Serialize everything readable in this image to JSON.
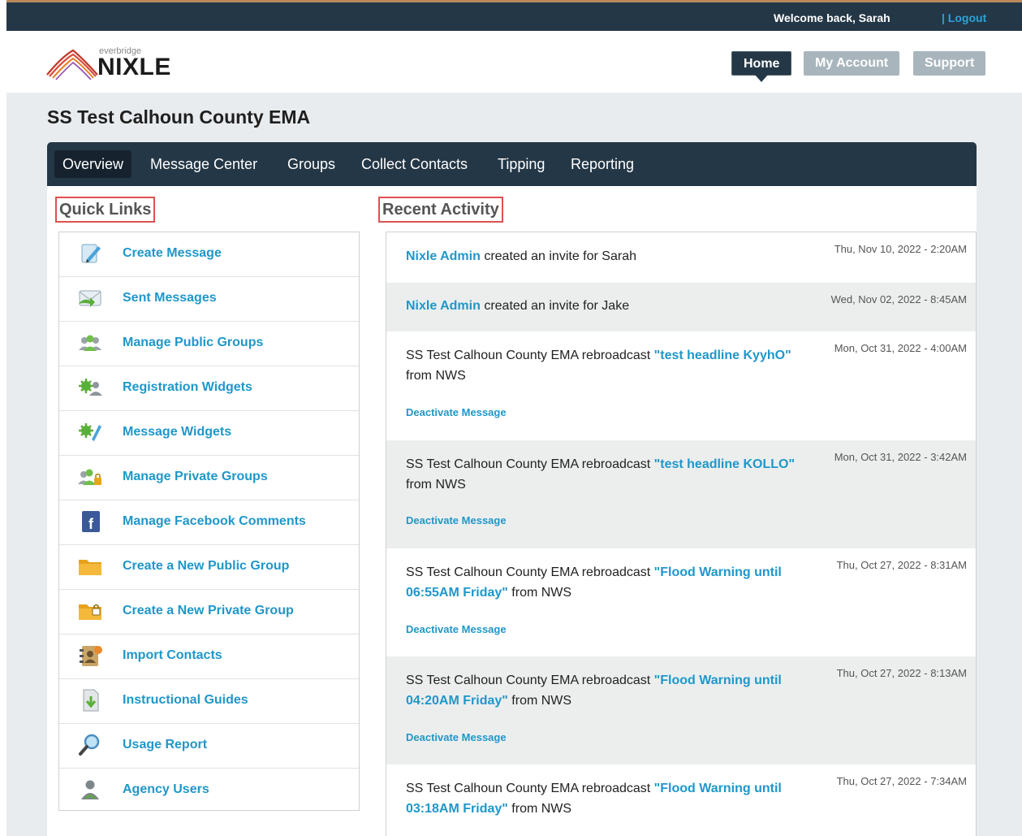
{
  "topbar": {
    "welcome": "Welcome back, Sarah",
    "logout": "| Logout"
  },
  "logo": {
    "small": "everbridge",
    "main": "NIXLE"
  },
  "header_nav": {
    "home": "Home",
    "my_account": "My Account",
    "support": "Support"
  },
  "page_title": "SS Test Calhoun County EMA",
  "main_nav": [
    {
      "label": "Overview"
    },
    {
      "label": "Message Center"
    },
    {
      "label": "Groups"
    },
    {
      "label": "Collect Contacts"
    },
    {
      "label": "Tipping"
    },
    {
      "label": "Reporting"
    }
  ],
  "quick_links": {
    "title": "Quick Links",
    "items": [
      {
        "label": "Create Message",
        "icon": "pencil-paper-icon"
      },
      {
        "label": "Sent Messages",
        "icon": "envelope-icon"
      },
      {
        "label": "Manage Public Groups",
        "icon": "group-icon"
      },
      {
        "label": "Registration Widgets",
        "icon": "gear-user-icon"
      },
      {
        "label": "Message Widgets",
        "icon": "gear-pencil-icon"
      },
      {
        "label": "Manage Private Groups",
        "icon": "private-group-icon"
      },
      {
        "label": "Manage Facebook Comments",
        "icon": "facebook-icon"
      },
      {
        "label": "Create a New Public Group",
        "icon": "folder-icon"
      },
      {
        "label": "Create a New Private Group",
        "icon": "locked-folder-icon"
      },
      {
        "label": "Import Contacts",
        "icon": "address-book-icon"
      },
      {
        "label": "Instructional Guides",
        "icon": "download-doc-icon"
      },
      {
        "label": "Usage Report",
        "icon": "magnifier-icon"
      },
      {
        "label": "Agency Users",
        "icon": "user-icon"
      }
    ]
  },
  "recent_activity": {
    "title": "Recent Activity",
    "deactivate_label": "Deactivate Message",
    "items": [
      {
        "actor": "Nixle Admin",
        "text": " created an invite for Sarah",
        "date": "Thu, Nov 10, 2022 - 2:20AM"
      },
      {
        "actor": "Nixle Admin",
        "text": " created an invite for Jake",
        "date": "Wed, Nov 02, 2022 - 8:45AM"
      },
      {
        "prefix": "SS Test Calhoun County EMA rebroadcast ",
        "headline": "\"test headline KyyhO\"",
        "suffix": " from NWS",
        "date": "Mon, Oct 31, 2022 - 4:00AM"
      },
      {
        "prefix": "SS Test Calhoun County EMA rebroadcast ",
        "headline": "\"test headline KOLLO\"",
        "suffix": " from NWS",
        "date": "Mon, Oct 31, 2022 - 3:42AM"
      },
      {
        "prefix": "SS Test Calhoun County EMA rebroadcast ",
        "headline": "\"Flood Warning until 06:55AM Friday\"",
        "suffix": " from NWS",
        "date": "Thu, Oct 27, 2022 - 8:31AM"
      },
      {
        "prefix": "SS Test Calhoun County EMA rebroadcast ",
        "headline": "\"Flood Warning until 04:20AM Friday\"",
        "suffix": " from NWS",
        "date": "Thu, Oct 27, 2022 - 8:13AM"
      },
      {
        "prefix": "SS Test Calhoun County EMA rebroadcast ",
        "headline": "\"Flood Warning until 03:18AM Friday\"",
        "suffix": " from NWS",
        "date": "Thu, Oct 27, 2022 - 7:34AM"
      }
    ]
  },
  "colors": {
    "navy": "#243746",
    "link": "#1f97c9",
    "highlight_box": "#e05050"
  }
}
